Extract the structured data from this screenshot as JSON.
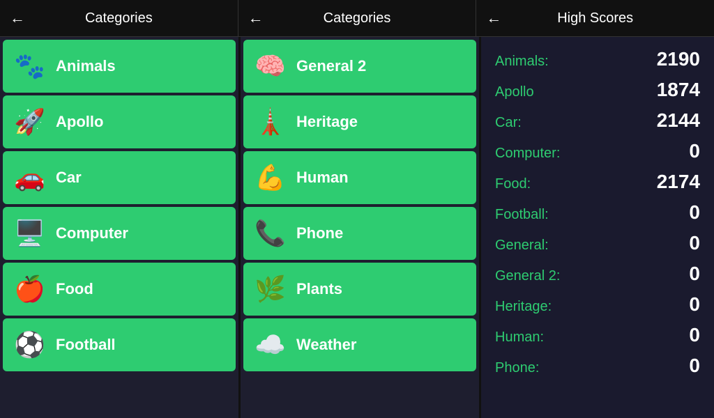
{
  "headers": [
    {
      "back": "←",
      "title": "Categories"
    },
    {
      "back": "←",
      "title": "Categories"
    },
    {
      "back": "←",
      "title": "High Scores"
    }
  ],
  "col1_categories": [
    {
      "icon": "🐾",
      "label": "Animals"
    },
    {
      "icon": "🚀",
      "label": "Apollo"
    },
    {
      "icon": "🚗",
      "label": "Car"
    },
    {
      "icon": "🖥️",
      "label": "Computer"
    },
    {
      "icon": "🍎",
      "label": "Food"
    },
    {
      "icon": "⚽",
      "label": "Football"
    }
  ],
  "col2_categories": [
    {
      "icon": "🧠",
      "label": "General 2"
    },
    {
      "icon": "🗼",
      "label": "Heritage"
    },
    {
      "icon": "💪",
      "label": "Human"
    },
    {
      "icon": "📞",
      "label": "Phone"
    },
    {
      "icon": "🌿",
      "label": "Plants"
    },
    {
      "icon": "☁️",
      "label": "Weather"
    }
  ],
  "high_scores": [
    {
      "label": "Animals:",
      "value": "2190"
    },
    {
      "label": "Apollo",
      "value": "1874"
    },
    {
      "label": "Car:",
      "value": "2144"
    },
    {
      "label": "Computer:",
      "value": "0"
    },
    {
      "label": "Food:",
      "value": "2174"
    },
    {
      "label": "Football:",
      "value": "0"
    },
    {
      "label": "General:",
      "value": "0"
    },
    {
      "label": "General 2:",
      "value": "0"
    },
    {
      "label": "Heritage:",
      "value": "0"
    },
    {
      "label": "Human:",
      "value": "0"
    },
    {
      "label": "Phone:",
      "value": "0"
    }
  ]
}
